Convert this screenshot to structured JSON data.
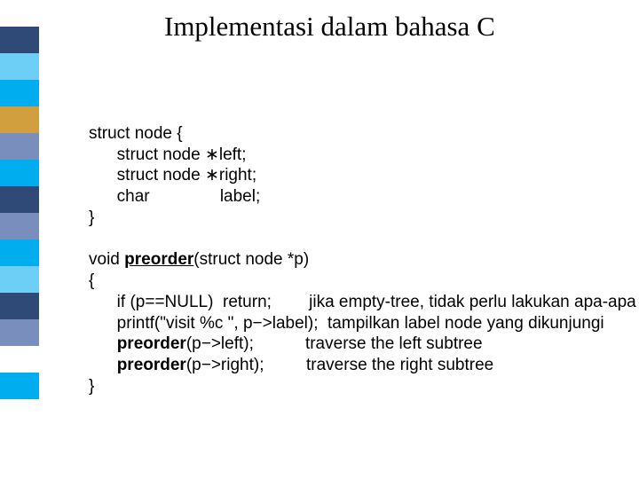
{
  "title": "Implementasi dalam bahasa C",
  "sidebar_colors": [
    "#ffffff",
    "#304a78",
    "#6dcff6",
    "#00aeef",
    "#d19f3e",
    "#7a8ebd",
    "#00aeef",
    "#304a78",
    "#7a8ebd",
    "#00aeef",
    "#6dcff6",
    "#304a78",
    "#7a8ebd",
    "#ffffff",
    "#00aeef",
    "#ffffff",
    "#ffffff",
    "#ffffff"
  ],
  "code": {
    "l1": "struct node {",
    "l2": "      struct node ∗left;",
    "l3": "      struct node ∗right;",
    "l4a": "      char",
    "l4b": "label;",
    "l5": "}",
    "l7": "void ",
    "l7b": "preorder",
    "l7c": "(struct node *p)",
    "l8": "{",
    "l9": "      if (p==NULL)  return;        jika empty-tree, tidak perlu lakukan apa-apa",
    "l10": "      printf(\"visit %c \", p−>label);  tampilkan label node yang dikunjungi",
    "l11a": "      ",
    "l11b": "preorder",
    "l11c": "(p−>left);",
    "l11d": "traverse the left subtree",
    "l12a": "      ",
    "l12b": "preorder",
    "l12c": "(p−>right);",
    "l12d": "traverse the right subtree",
    "l13": "}"
  }
}
